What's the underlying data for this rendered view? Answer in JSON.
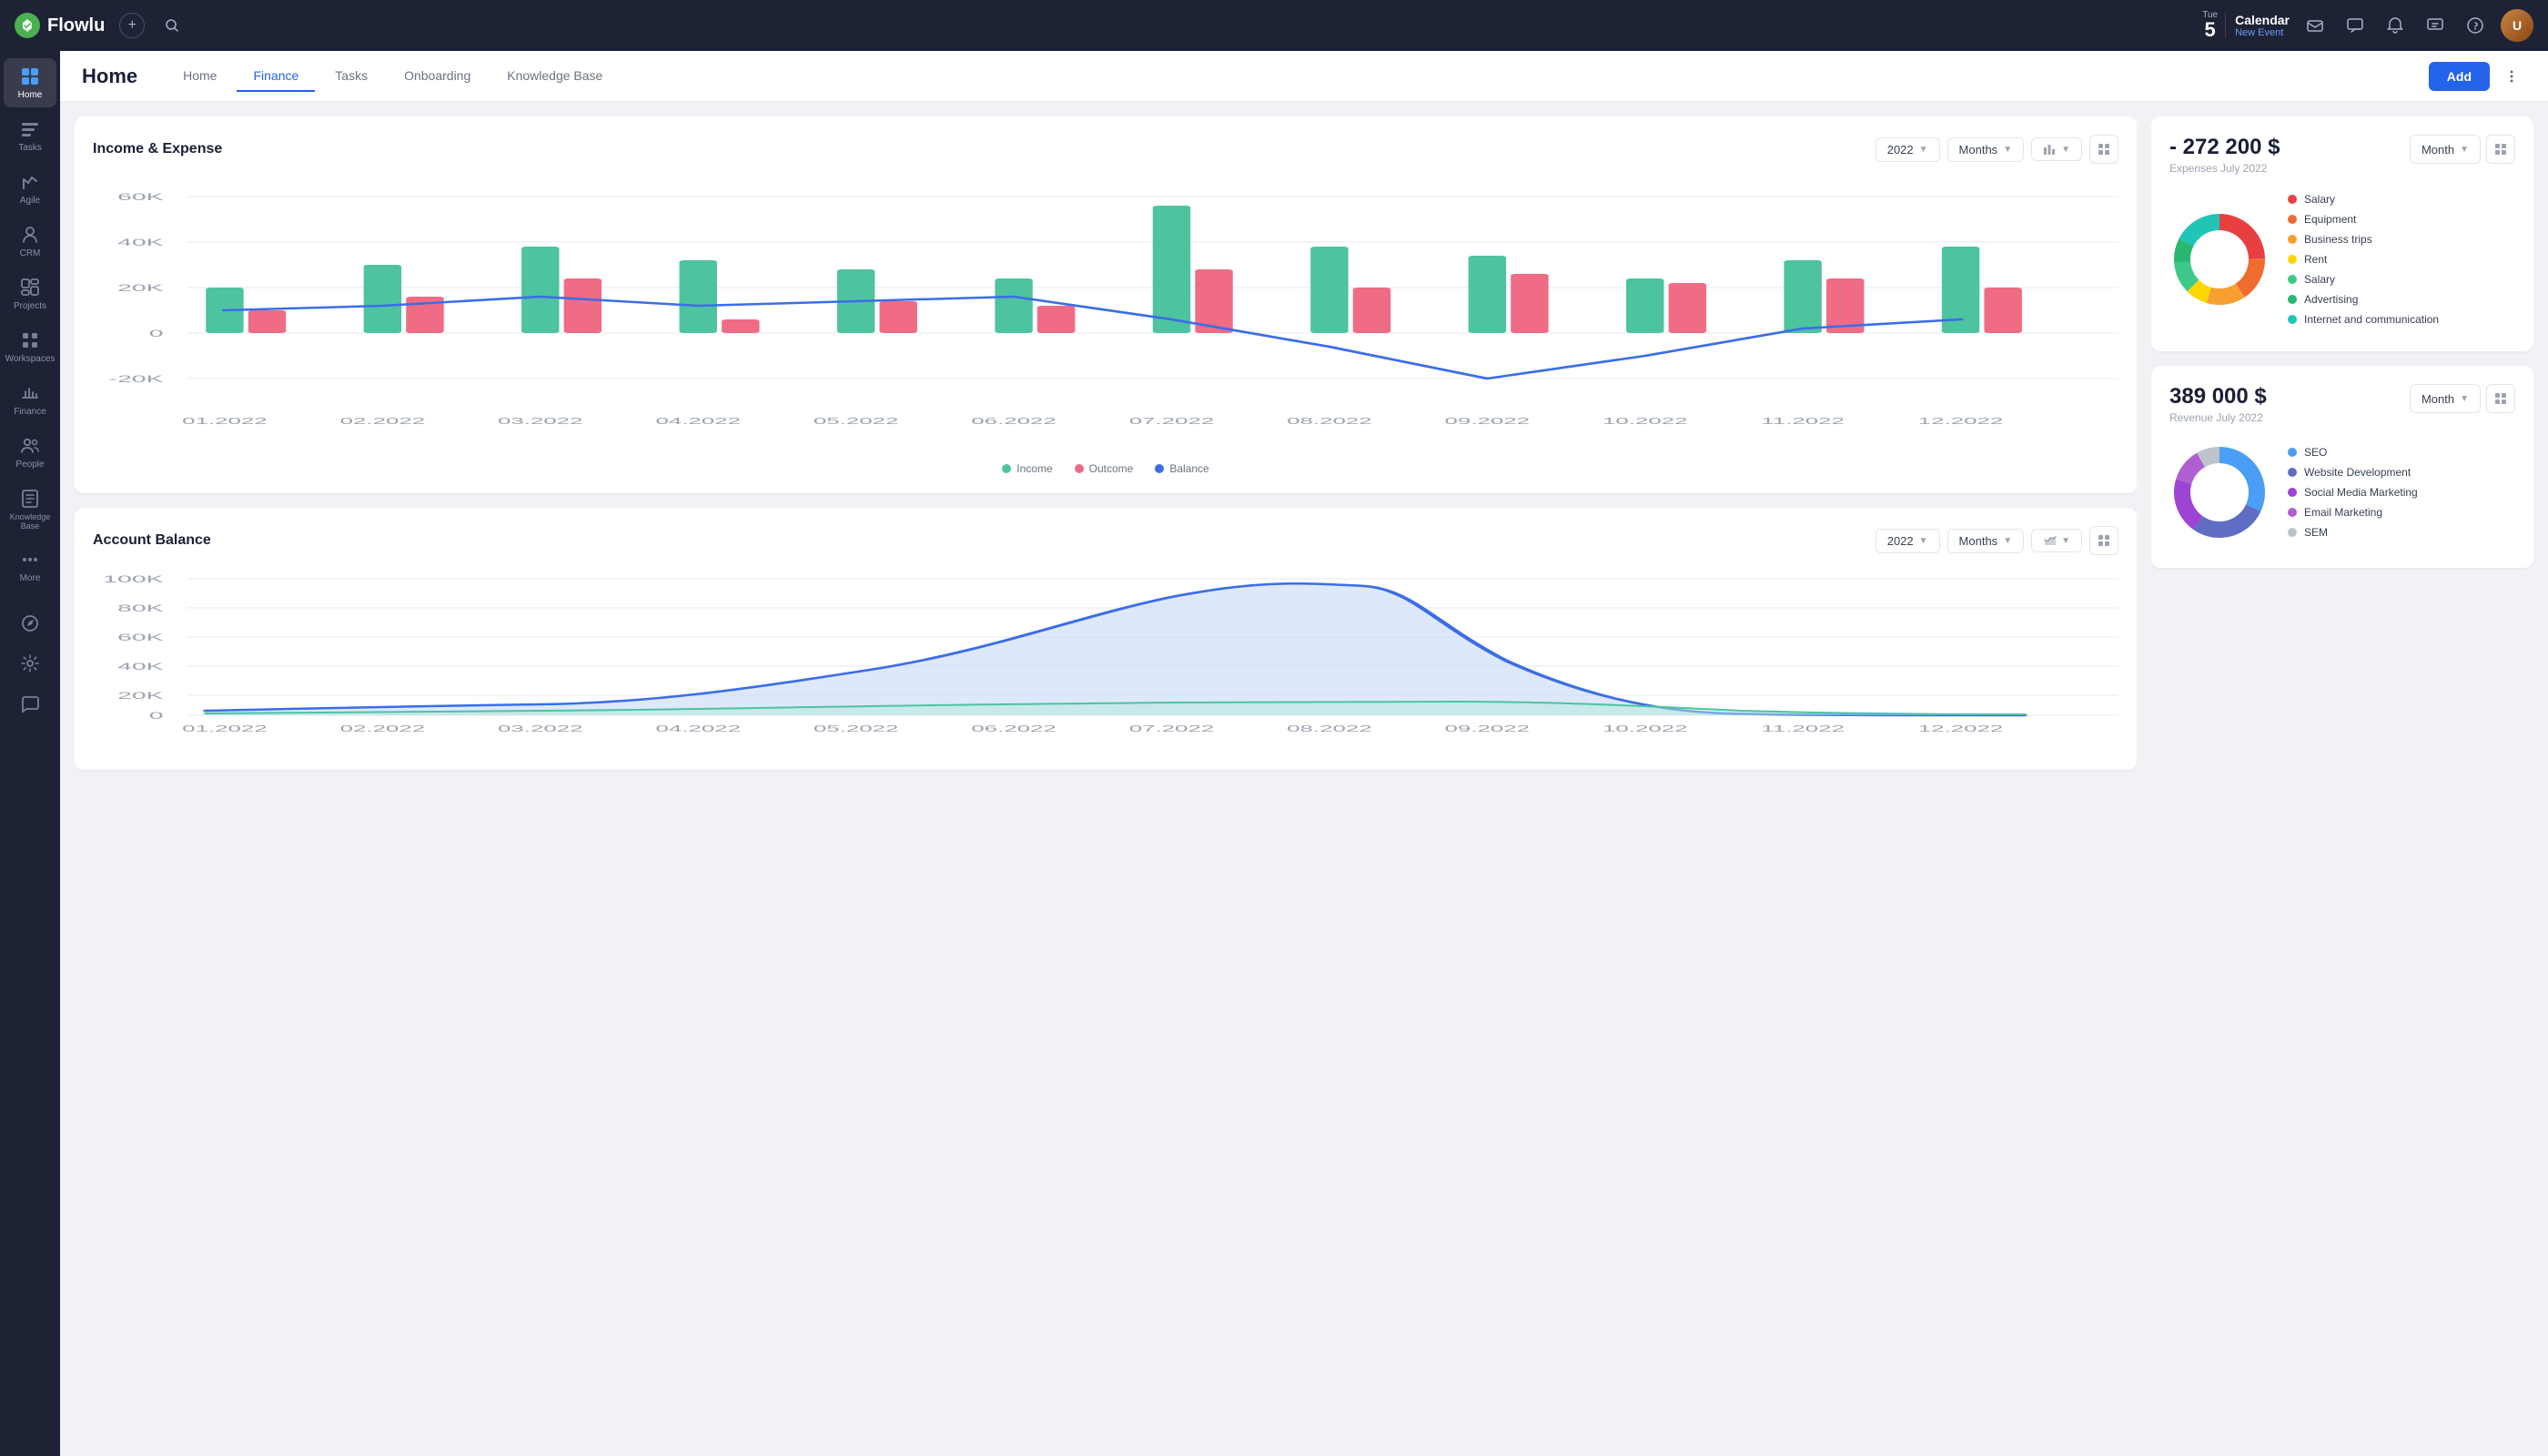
{
  "topbar": {
    "logo_text": "Flowlu",
    "calendar_day": "Tue",
    "calendar_num": "5",
    "calendar_title": "Calendar",
    "calendar_sub": "New Event",
    "plus_title": "+",
    "search_title": "Search"
  },
  "sidebar": {
    "items": [
      {
        "id": "home",
        "label": "Home",
        "active": true
      },
      {
        "id": "tasks",
        "label": "Tasks",
        "active": false
      },
      {
        "id": "agile",
        "label": "Agile",
        "active": false
      },
      {
        "id": "crm",
        "label": "CRM",
        "active": false
      },
      {
        "id": "projects",
        "label": "Projects",
        "active": false
      },
      {
        "id": "workspaces",
        "label": "Workspaces",
        "active": false
      },
      {
        "id": "finance",
        "label": "Finance",
        "active": false
      },
      {
        "id": "people",
        "label": "People",
        "active": false
      },
      {
        "id": "knowledge",
        "label": "Knowledge Base",
        "active": false
      },
      {
        "id": "more",
        "label": "More",
        "active": false
      }
    ]
  },
  "subheader": {
    "title": "Home",
    "tabs": [
      "Home",
      "Finance",
      "Tasks",
      "Onboarding",
      "Knowledge Base"
    ],
    "active_tab": "Finance",
    "add_label": "Add"
  },
  "income_expense": {
    "title": "Income & Expense",
    "year_label": "2022",
    "period_label": "Months",
    "legend": [
      {
        "label": "Income",
        "color": "#4dc3a0"
      },
      {
        "label": "Outcome",
        "color": "#f06b84"
      },
      {
        "label": "Balance",
        "color": "#3b6de8"
      }
    ],
    "x_labels": [
      "01.2022",
      "02.2022",
      "03.2022",
      "04.2022",
      "05.2022",
      "06.2022",
      "07.2022",
      "08.2022",
      "09.2022",
      "10.2022",
      "11.2022",
      "12.2022"
    ],
    "y_labels": [
      "60K",
      "40K",
      "20K",
      "0",
      "-20K"
    ]
  },
  "account_balance": {
    "title": "Account Balance",
    "year_label": "2022",
    "period_label": "Months",
    "x_labels": [
      "01.2022",
      "02.2022",
      "03.2022",
      "04.2022",
      "05.2022",
      "06.2022",
      "07.2022",
      "08.2022",
      "09.2022",
      "10.2022",
      "11.2022",
      "12.2022"
    ],
    "y_labels": [
      "100K",
      "80K",
      "60K",
      "40K",
      "20K",
      "0"
    ]
  },
  "expenses_card": {
    "amount": "- 272 200 $",
    "label": "Expenses July 2022",
    "period_label": "Month",
    "legend": [
      {
        "label": "Salary",
        "color": "#e84040"
      },
      {
        "label": "Equipment",
        "color": "#f06b30"
      },
      {
        "label": "Business trips",
        "color": "#f7a030"
      },
      {
        "label": "Rent",
        "color": "#ffd700"
      },
      {
        "label": "Salary",
        "color": "#3ec98a"
      },
      {
        "label": "Advertising",
        "color": "#28b870"
      },
      {
        "label": "Internet and communication",
        "color": "#20c5b8"
      }
    ]
  },
  "revenue_card": {
    "amount": "389 000 $",
    "label": "Revenue July 2022",
    "period_label": "Month",
    "legend": [
      {
        "label": "SEO",
        "color": "#4b9ef5"
      },
      {
        "label": "Website Development",
        "color": "#5f6ec4"
      },
      {
        "label": "Social Media Marketing",
        "color": "#9e44d4"
      },
      {
        "label": "Email Marketing",
        "color": "#b060d0"
      },
      {
        "label": "SEM",
        "color": "#bdc3cc"
      }
    ]
  }
}
